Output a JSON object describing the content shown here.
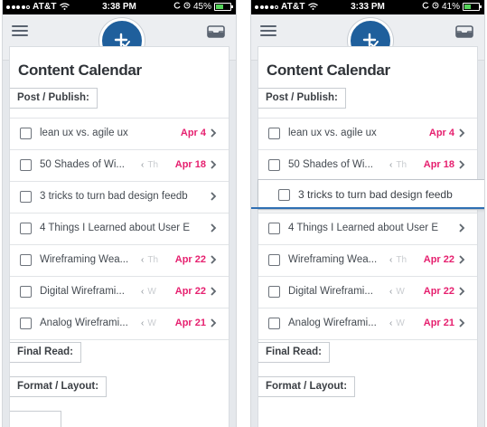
{
  "screens": [
    {
      "status": {
        "carrier": "AT&T",
        "time": "3:38 PM",
        "battery": "45%"
      },
      "title": "Content Calendar",
      "sections": {
        "post_publish": "Post / Publish:",
        "final_read": "Final Read:",
        "format_layout": "Format / Layout:"
      },
      "tasks": [
        {
          "text": "lean ux vs. agile ux",
          "hint": "",
          "date": "Apr 4"
        },
        {
          "text": "50 Shades of Wi...",
          "hint": "Th",
          "date": "Apr 18"
        },
        {
          "text": "3 tricks to turn bad design feedb",
          "hint": "",
          "date": ""
        },
        {
          "text": "4 Things I Learned about User E",
          "hint": "",
          "date": ""
        },
        {
          "text": "Wireframing Wea...",
          "hint": "Th",
          "date": "Apr 22"
        },
        {
          "text": "Digital Wireframi...",
          "hint": "W",
          "date": "Apr 22"
        },
        {
          "text": "Analog Wireframi...",
          "hint": "W",
          "date": "Apr 21"
        }
      ]
    },
    {
      "status": {
        "carrier": "AT&T",
        "time": "3:33 PM",
        "battery": "41%"
      },
      "title": "Content Calendar",
      "sections": {
        "post_publish": "Post / Publish:",
        "final_read": "Final Read:",
        "format_layout": "Format / Layout:"
      },
      "tasks": [
        {
          "text": "lean ux vs. agile ux",
          "hint": "",
          "date": "Apr 4"
        },
        {
          "text": "50 Shades of Wi...",
          "hint": "Th",
          "date": "Apr 18"
        },
        {
          "text": "4 Things I Learned about User E",
          "hint": "",
          "date": ""
        },
        {
          "text": "Wireframing Wea...",
          "hint": "Th",
          "date": "Apr 22"
        },
        {
          "text": "Digital Wireframi...",
          "hint": "W",
          "date": "Apr 22"
        },
        {
          "text": "Analog Wireframi...",
          "hint": "W",
          "date": "Apr 21"
        }
      ],
      "dragging_task": "3 tricks to turn bad design feedb"
    }
  ],
  "colors": {
    "accent": "#1f5f9c",
    "date": "#e6206f",
    "drop_indicator": "#2f6fb3"
  },
  "icons": {
    "menu": "hamburger-icon",
    "add": "add-task-icon",
    "inbox": "inbox-icon",
    "row": "chevron-right-icon"
  }
}
